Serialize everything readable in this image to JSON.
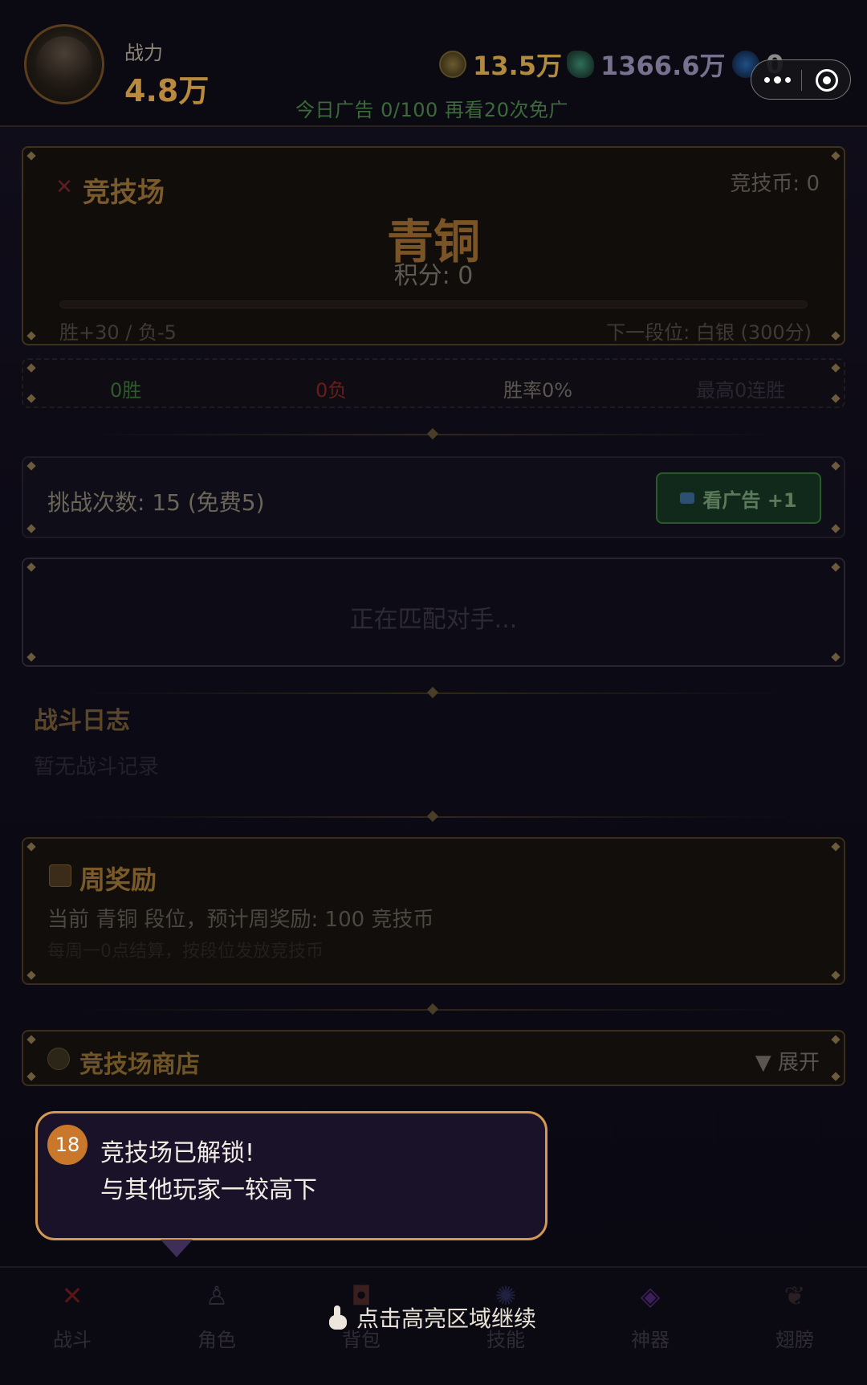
{
  "header": {
    "power_label": "战力",
    "power_value": "4.8万",
    "gold": "13.5万",
    "gems": "1366.6万",
    "orbs": "0",
    "ad_info": "今日广告 0/100  再看20次免广"
  },
  "arena": {
    "title": "竞技场",
    "coin": "竞技币: 0",
    "rank": "青铜",
    "score": "积分: 0",
    "progress": 0,
    "rule": "胜+30 / 负-5",
    "next_rank": "下一段位: 白银 (300分)"
  },
  "stats": {
    "wins": "0胜",
    "losses": "0负",
    "win_rate": "胜率0%",
    "best_streak": "最高0连胜"
  },
  "challenge": {
    "count_text": "挑战次数: 15 (免费5)",
    "ad_button": "看广告 +1"
  },
  "match": {
    "status": "正在匹配对手..."
  },
  "battle_log": {
    "title": "战斗日志",
    "empty": "暂无战斗记录"
  },
  "weekly": {
    "title": "周奖励",
    "line1": "当前 青铜 段位，预计周奖励: 100 竞技币",
    "line2": "每周一0点结算，按段位发放竞技币"
  },
  "shop": {
    "title": "竞技场商店",
    "toggle": "▼ 展开"
  },
  "tutorial": {
    "step": "18",
    "line1": "竞技场已解锁!",
    "line2": "与其他玩家一较高下",
    "continue_hint": "点击高亮区域继续"
  },
  "nav": [
    {
      "label": "战斗",
      "icon": "crossed-swords-icon"
    },
    {
      "label": "角色",
      "icon": "character-icon"
    },
    {
      "label": "背包",
      "icon": "backpack-icon"
    },
    {
      "label": "技能",
      "icon": "skill-icon"
    },
    {
      "label": "神器",
      "icon": "artifact-icon"
    },
    {
      "label": "翅膀",
      "icon": "wings-icon"
    }
  ]
}
